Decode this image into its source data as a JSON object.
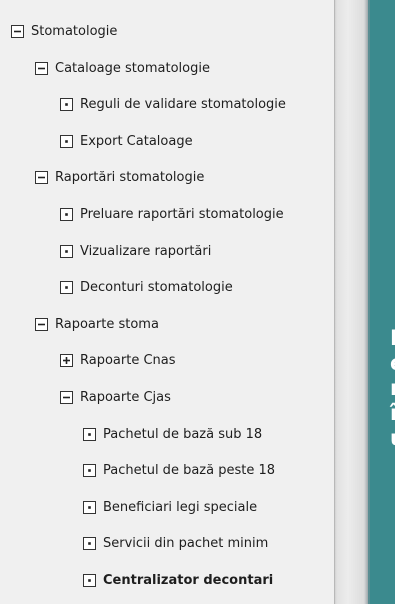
{
  "tree": {
    "items": [
      {
        "label": "Stomatologie",
        "toggle": "expanded",
        "level": 0
      },
      {
        "label": "Cataloage stomatologie",
        "toggle": "expanded",
        "level": 1
      },
      {
        "label": "Reguli de validare stomatologie",
        "toggle": "leaf",
        "level": 2
      },
      {
        "label": "Export Cataloage",
        "toggle": "leaf",
        "level": 2
      },
      {
        "label": "Raportări stomatologie",
        "toggle": "expanded",
        "level": 1
      },
      {
        "label": "Preluare raportări stomatologie",
        "toggle": "leaf",
        "level": 2
      },
      {
        "label": "Vizualizare raportări",
        "toggle": "leaf",
        "level": 2
      },
      {
        "label": "Deconturi stomatologie",
        "toggle": "leaf",
        "level": 2
      },
      {
        "label": "Rapoarte stoma",
        "toggle": "expanded",
        "level": 1
      },
      {
        "label": "Rapoarte Cnas",
        "toggle": "collapsed",
        "level": 2
      },
      {
        "label": "Rapoarte Cjas",
        "toggle": "expanded",
        "level": 2
      },
      {
        "label": "Pachetul de bază sub 18",
        "toggle": "leaf",
        "level": 3
      },
      {
        "label": "Pachetul de bază peste 18",
        "toggle": "leaf",
        "level": 3
      },
      {
        "label": "Beneficiari legi speciale",
        "toggle": "leaf",
        "level": 3
      },
      {
        "label": "Servicii din pachet minim",
        "toggle": "leaf",
        "level": 3
      },
      {
        "label": "Centralizator decontari",
        "toggle": "leaf",
        "level": 3,
        "bold": true
      }
    ]
  },
  "right_panel": {
    "background": "#3b8a8e",
    "text_lines": [
      "M",
      "e",
      "n",
      "î",
      "u"
    ]
  }
}
